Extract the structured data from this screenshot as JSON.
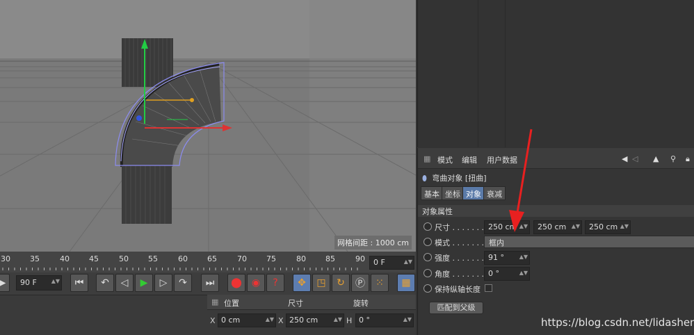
{
  "viewport": {
    "grid_label": "网格间距 : 1000 cm"
  },
  "timeline": {
    "ticks": [
      "30",
      "35",
      "40",
      "45",
      "50",
      "55",
      "60",
      "65",
      "70",
      "75",
      "80",
      "85",
      "90"
    ],
    "current_frame": "0 F"
  },
  "transport": {
    "end_frame": "90 F"
  },
  "coords": {
    "position_label": "位置",
    "size_label": "尺寸",
    "rotation_label": "旋转",
    "pos_x_axis": "X",
    "pos_x": "0 cm",
    "size_x_axis": "X",
    "size_x": "250 cm",
    "rot_h_axis": "H",
    "rot_h": "0 °"
  },
  "attr": {
    "menu": {
      "mode": "模式",
      "edit": "编辑",
      "userdata": "用户数据"
    },
    "object_title": "弯曲对象 [扭曲]",
    "tabs": {
      "basic": "基本",
      "coord": "坐标",
      "object": "对象",
      "falloff": "衰减"
    },
    "section": "对象属性",
    "size_label": "尺寸 . . . . . . .",
    "size_x": "250 cm",
    "size_y": "250 cm",
    "size_z": "250 cm",
    "mode_label": "模式 . . . . . . .",
    "mode_value": "框内",
    "strength_label": "强度 . . . . . . .",
    "strength_value": "91 °",
    "angle_label": "角度 . . . . . . .",
    "angle_value": "0 °",
    "keep_label": "保持纵轴长度",
    "match_button": "匹配到父级"
  },
  "watermark": "https://blog.csdn.net/lidashent"
}
